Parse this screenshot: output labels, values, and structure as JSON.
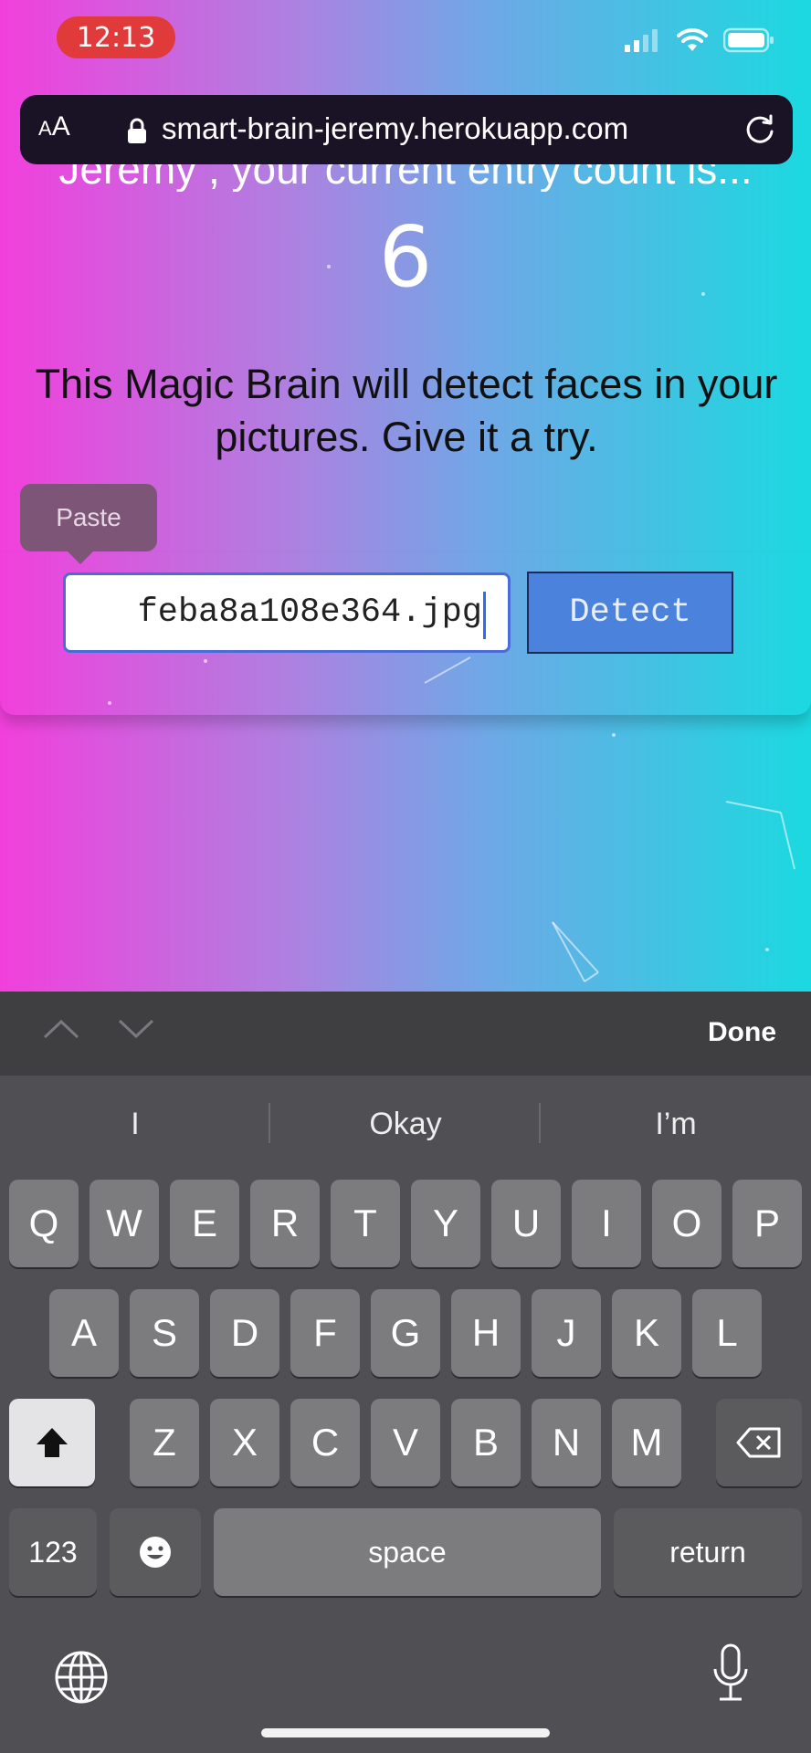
{
  "status_bar": {
    "time": "12:13"
  },
  "browser": {
    "text_size_label_small": "A",
    "text_size_label_large": "A",
    "url": "smart-brain-jeremy.herokuapp.com"
  },
  "page": {
    "header_partial": "Jeremy , your current entry count is...",
    "entry_count": "6",
    "description": "This Magic Brain will detect faces in your pictures. Give it a try.",
    "input_value": "feba8a108e364.jpg",
    "detect_label": "Detect"
  },
  "context_menu": {
    "paste_label": "Paste"
  },
  "keyboard": {
    "done_label": "Done",
    "suggestions": [
      "I",
      "Okay",
      "I’m"
    ],
    "row1": [
      "Q",
      "W",
      "E",
      "R",
      "T",
      "Y",
      "U",
      "I",
      "O",
      "P"
    ],
    "row2": [
      "A",
      "S",
      "D",
      "F",
      "G",
      "H",
      "J",
      "K",
      "L"
    ],
    "row3": [
      "Z",
      "X",
      "C",
      "V",
      "B",
      "N",
      "M"
    ],
    "numbers_label": "123",
    "space_label": "space",
    "return_label": "return"
  },
  "icons": [
    "signal-icon",
    "wifi-icon",
    "battery-icon",
    "lock-icon",
    "reload-icon",
    "chevron-up-icon",
    "chevron-down-icon",
    "shift-icon",
    "backspace-icon",
    "emoji-icon",
    "globe-icon",
    "microphone-icon"
  ]
}
